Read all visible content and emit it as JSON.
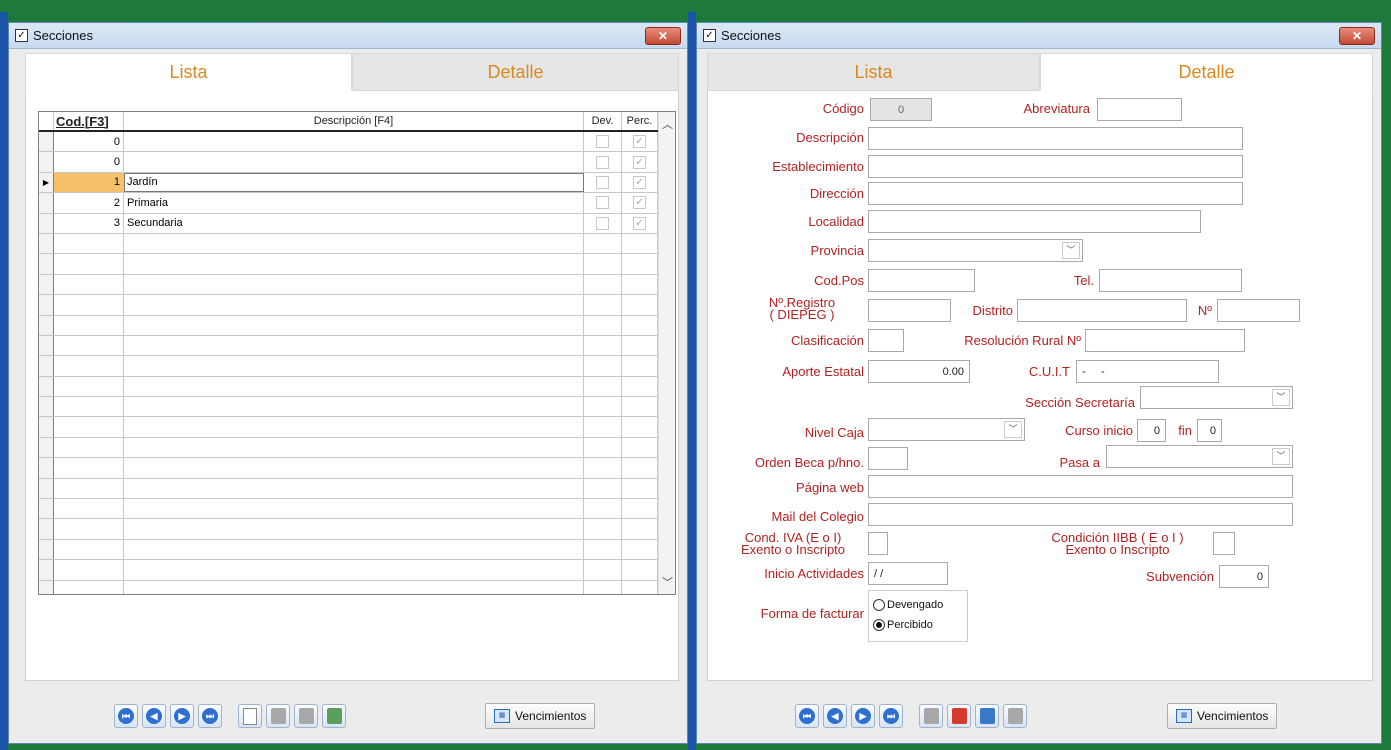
{
  "left_window": {
    "title": "Secciones",
    "tabs": [
      "Lista",
      "Detalle"
    ],
    "columns": [
      "Cod.[F3]",
      "Descripción [F4]",
      "Dev.",
      "Perc."
    ],
    "rows": [
      {
        "code": "0",
        "desc": "",
        "dev": false,
        "perc": true
      },
      {
        "code": "0",
        "desc": "",
        "dev": false,
        "perc": true
      },
      {
        "code": "1",
        "desc": "Jardín",
        "dev": false,
        "perc": true,
        "selected": true
      },
      {
        "code": "2",
        "desc": "Primaria",
        "dev": false,
        "perc": true
      },
      {
        "code": "3",
        "desc": "Secundaria",
        "dev": false,
        "perc": true
      }
    ],
    "vencimientos": "Vencimientos"
  },
  "right_window": {
    "title": "Secciones",
    "tabs": [
      "Lista",
      "Detalle"
    ],
    "labels": {
      "codigo": "Código",
      "abreviatura": "Abreviatura",
      "descripcion": "Descripción",
      "establecimiento": "Establecimiento",
      "direccion": "Dirección",
      "localidad": "Localidad",
      "provincia": "Provincia",
      "codpos": "Cod.Pos",
      "tel": "Tel.",
      "registro1": "Nº.Registro",
      "registro2": "( DIEPEG )",
      "distrito": "Distrito",
      "numero": "Nº",
      "clasificacion": "Clasificación",
      "resolucion": "Resolución Rural Nº",
      "aporte": "Aporte Estatal",
      "cuit": "C.U.I.T",
      "seccion_secretaria": "Sección Secretaría",
      "nivel_caja": "Nivel Caja",
      "curso_inicio": "Curso inicio",
      "fin": "fin",
      "orden_beca": "Orden Beca p/hno.",
      "pasa_a": "Pasa a",
      "pagina_web": "Página web",
      "mail": "Mail del Colegio",
      "cond_iva1": "Cond. IVA (E o I)",
      "cond_iva2": "Exento o Inscripto",
      "cond_iibb1": "Condición IIBB ( E o I )",
      "cond_iibb2": "Exento o Inscripto",
      "inicio_actividades": "Inicio Actividades",
      "subvencion": "Subvención",
      "forma_facturar": "Forma de facturar"
    },
    "values": {
      "codigo": "0",
      "aporte": "0.00",
      "cuit": "-     -",
      "curso_inicio": "0",
      "fin": "0",
      "inicio_actividades": "/ /",
      "subvencion": "0"
    },
    "radio_options": [
      "Devengado",
      "Percibido"
    ],
    "radio_selected": "Percibido",
    "vencimientos": "Vencimientos"
  }
}
